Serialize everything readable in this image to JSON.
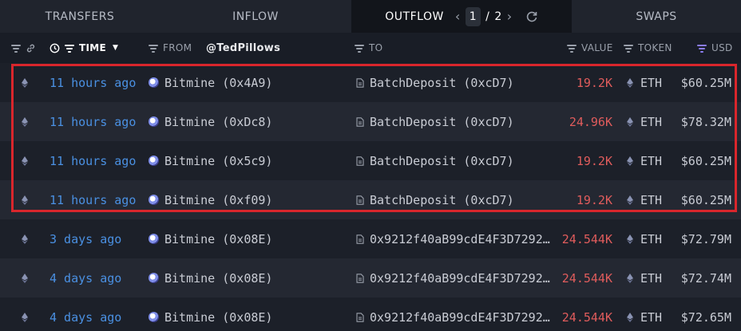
{
  "tabs": [
    {
      "label": "TRANSFERS"
    },
    {
      "label": "INFLOW"
    },
    {
      "label": "OUTFLOW"
    },
    {
      "label": "SWAPS"
    }
  ],
  "pager": {
    "current": "1",
    "separator": "/",
    "total": "2"
  },
  "header": {
    "time": "TIME",
    "from": "FROM",
    "handle": "@TedPillows",
    "to": "TO",
    "value": "VALUE",
    "token": "TOKEN",
    "usd": "USD"
  },
  "rows": [
    {
      "time": "11 hours ago",
      "from": "Bitmine (0x4A9)",
      "to": "BatchDeposit (0xcD7)",
      "value": "19.2K",
      "token": "ETH",
      "usd": "$60.25M"
    },
    {
      "time": "11 hours ago",
      "from": "Bitmine (0xDc8)",
      "to": "BatchDeposit (0xcD7)",
      "value": "24.96K",
      "token": "ETH",
      "usd": "$78.32M"
    },
    {
      "time": "11 hours ago",
      "from": "Bitmine (0x5c9)",
      "to": "BatchDeposit (0xcD7)",
      "value": "19.2K",
      "token": "ETH",
      "usd": "$60.25M"
    },
    {
      "time": "11 hours ago",
      "from": "Bitmine (0xf09)",
      "to": "BatchDeposit (0xcD7)",
      "value": "19.2K",
      "token": "ETH",
      "usd": "$60.25M"
    },
    {
      "time": "3 days ago",
      "from": "Bitmine (0x08E)",
      "to": "0x9212f40aB99cdE4F3D7292…",
      "value": "24.544K",
      "token": "ETH",
      "usd": "$72.79M"
    },
    {
      "time": "4 days ago",
      "from": "Bitmine (0x08E)",
      "to": "0x9212f40aB99cdE4F3D7292…",
      "value": "24.544K",
      "token": "ETH",
      "usd": "$72.74M"
    },
    {
      "time": "4 days ago",
      "from": "Bitmine (0x08E)",
      "to": "0x9212f40aB99cdE4F3D7292…",
      "value": "24.544K",
      "token": "ETH",
      "usd": "$72.65M"
    }
  ],
  "colors": {
    "accent_time": "#4a90e2",
    "value_red": "#e05c5c",
    "highlight": "#d9262c",
    "usd_filter": "#8b7cf0"
  }
}
